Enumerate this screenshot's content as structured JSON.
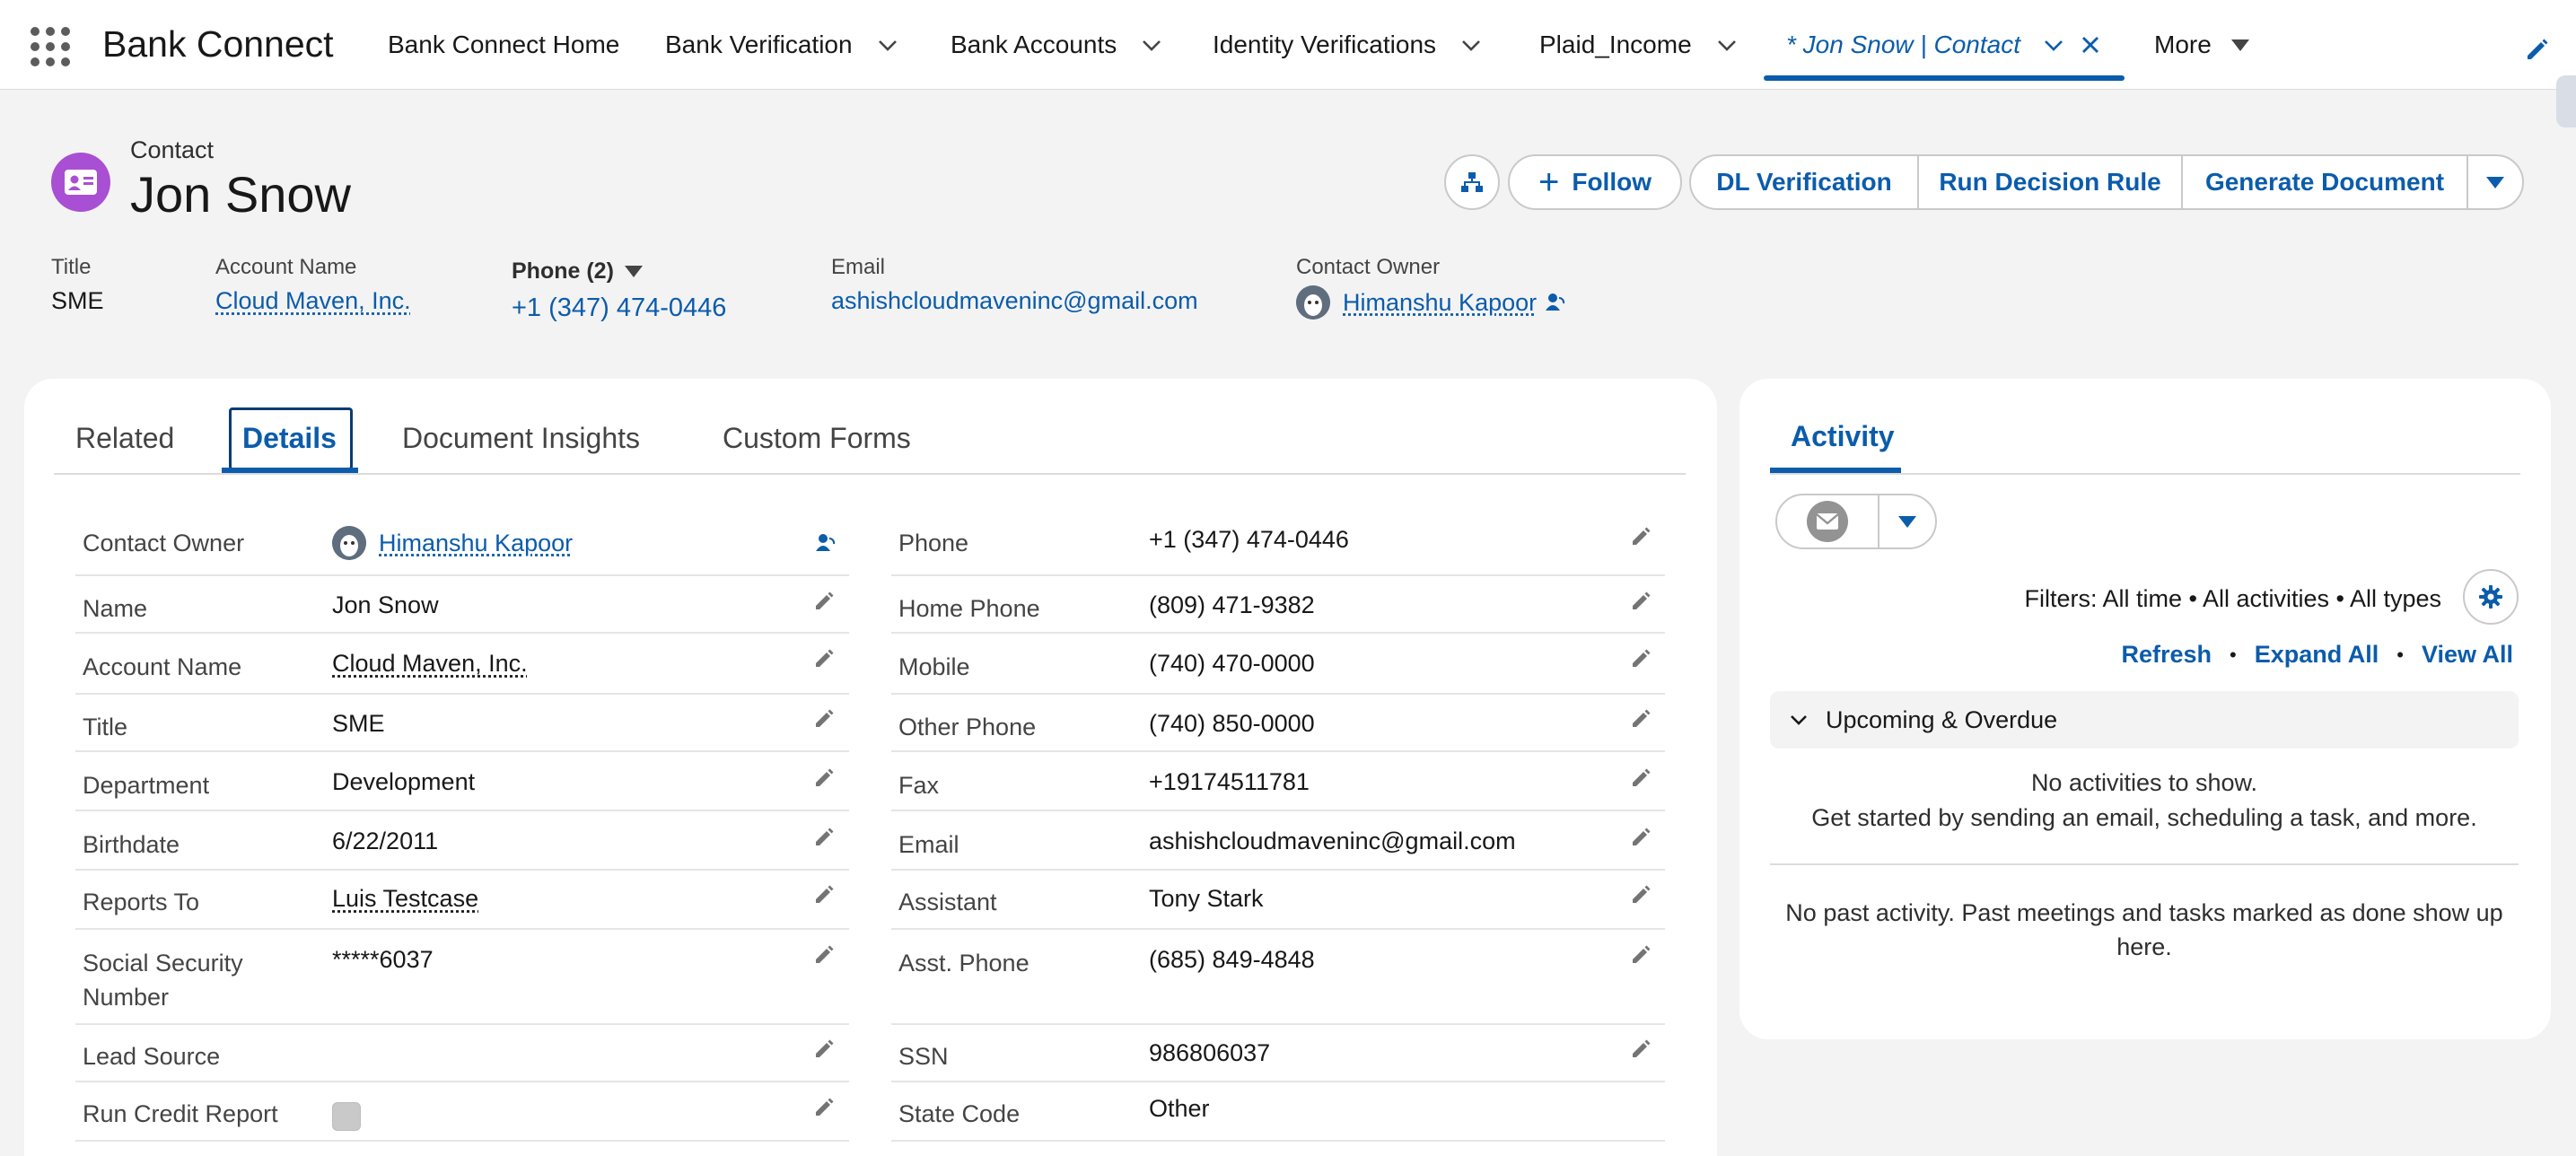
{
  "app": {
    "name": "Bank Connect"
  },
  "nav": {
    "items": [
      {
        "label": "Bank Connect Home"
      },
      {
        "label": "Bank Verification"
      },
      {
        "label": "Bank Accounts"
      },
      {
        "label": "Identity Verifications"
      },
      {
        "label": "Plaid_Income"
      },
      {
        "label": "* Jon Snow | Contact"
      },
      {
        "label": "More"
      }
    ]
  },
  "record": {
    "type": "Contact",
    "name": "Jon Snow",
    "actions": {
      "follow": "Follow",
      "dl_verification": "DL Verification",
      "run_decision_rule": "Run Decision Rule",
      "generate_document": "Generate Document"
    },
    "highlights": {
      "title_label": "Title",
      "title_value": "SME",
      "account_label": "Account Name",
      "account_value": "Cloud Maven, Inc.",
      "phone_label": "Phone (2)",
      "phone_value": "+1 (347) 474-0446",
      "email_label": "Email",
      "email_value": "ashishcloudmaveninc@gmail.com",
      "owner_label": "Contact Owner",
      "owner_value": "Himanshu Kapoor"
    }
  },
  "tabs": {
    "related": "Related",
    "details": "Details",
    "insights": "Document Insights",
    "forms": "Custom Forms"
  },
  "details": {
    "left": [
      {
        "label": "Contact Owner",
        "value": "Himanshu Kapoor"
      },
      {
        "label": "Name",
        "value": "Jon Snow"
      },
      {
        "label": "Account Name",
        "value": "Cloud Maven, Inc."
      },
      {
        "label": "Title",
        "value": "SME"
      },
      {
        "label": "Department",
        "value": "Development"
      },
      {
        "label": "Birthdate",
        "value": "6/22/2011"
      },
      {
        "label": "Reports To",
        "value": "Luis Testcase"
      },
      {
        "label": "Social Security",
        "label2": "Number",
        "value": "*****6037"
      },
      {
        "label": "Lead Source",
        "value": ""
      },
      {
        "label": "Run Credit Report",
        "value": ""
      }
    ],
    "right": [
      {
        "label": "Phone",
        "value": "+1 (347) 474-0446"
      },
      {
        "label": "Home Phone",
        "value": "(809) 471-9382"
      },
      {
        "label": "Mobile",
        "value": "(740) 470-0000"
      },
      {
        "label": "Other Phone",
        "value": "(740) 850-0000"
      },
      {
        "label": "Fax",
        "value": "+19174511781"
      },
      {
        "label": "Email",
        "value": "ashishcloudmaveninc@gmail.com"
      },
      {
        "label": "Assistant",
        "value": "Tony Stark"
      },
      {
        "label": "Asst. Phone",
        "value": "(685) 849-4848"
      },
      {
        "label": "SSN",
        "value": "986806037"
      },
      {
        "label": "State Code",
        "value": "Other"
      }
    ]
  },
  "activity": {
    "tab": "Activity",
    "filters": "Filters: All time • All activities • All types",
    "refresh": "Refresh",
    "expand_all": "Expand All",
    "view_all": "View All",
    "upcoming": "Upcoming & Overdue",
    "no_activities": "No activities to show.",
    "get_started": "Get started by sending an email, scheduling a task, and more.",
    "no_past_1": "No past activity. Past meetings and tasks marked as done show up",
    "no_past_2": "here."
  }
}
